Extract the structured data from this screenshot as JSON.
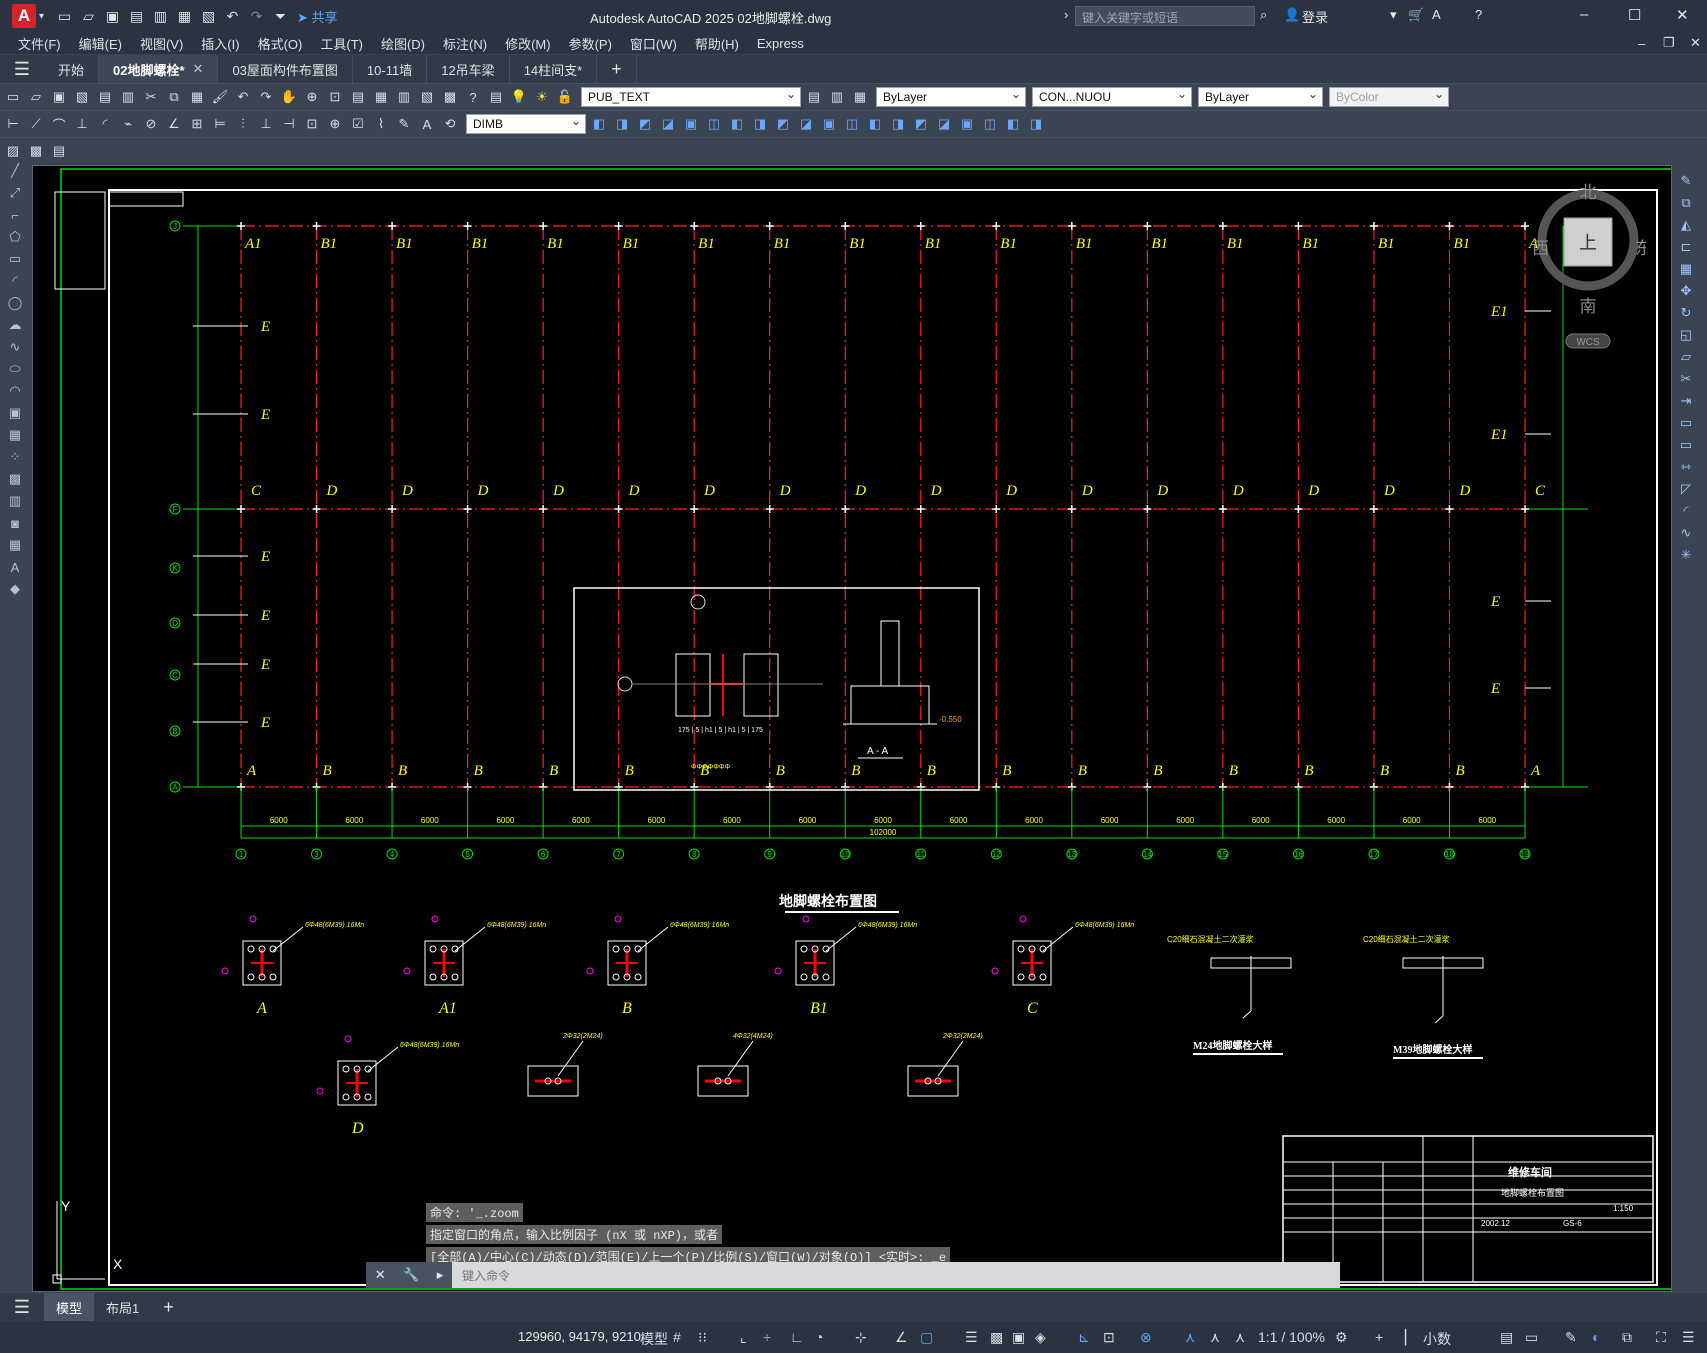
{
  "titlebar": {
    "app_logo": "A",
    "share_label": "共享",
    "app_title": "Autodesk AutoCAD 2025    02地脚螺栓.dwg",
    "search_placeholder": "键入关键字或短语",
    "signin_label": "登录"
  },
  "menu": [
    "文件(F)",
    "编辑(E)",
    "视图(V)",
    "插入(I)",
    "格式(O)",
    "工具(T)",
    "绘图(D)",
    "标注(N)",
    "修改(M)",
    "参数(P)",
    "窗口(W)",
    "帮助(H)",
    "Express"
  ],
  "tabs": [
    {
      "label": "开始"
    },
    {
      "label": "02地脚螺栓*",
      "close": "✕"
    },
    {
      "label": "03屋面构件布置图"
    },
    {
      "label": "10-11墙"
    },
    {
      "label": "12吊车梁"
    },
    {
      "label": "14柱间支*"
    }
  ],
  "properties": {
    "layer": "PUB_TEXT",
    "color": "ByLayer",
    "linetype": "CON...NUOU",
    "lineweight": "ByLayer",
    "plotstyle": "ByColor",
    "dimstyle": "DIMB"
  },
  "drawing": {
    "main_title": "地脚螺栓布置图",
    "grid_numbers": [
      "1",
      "3",
      "4",
      "5",
      "6",
      "7",
      "8",
      "9",
      "10",
      "11",
      "12",
      "13",
      "14",
      "15",
      "16",
      "17",
      "18",
      "19"
    ],
    "grid_letters": [
      "J",
      "F",
      "K",
      "D",
      "C",
      "B",
      "A"
    ],
    "total_dim": "102000",
    "bay_dim": "6000",
    "top_labels": [
      "A1",
      "B1",
      "B1",
      "B1",
      "B1",
      "B1",
      "B1",
      "B1",
      "B1",
      "B1",
      "B1",
      "B1",
      "B1",
      "B1",
      "B1",
      "B1",
      "B1",
      "A1"
    ],
    "mid_labels": [
      "C",
      "D",
      "D",
      "D",
      "D",
      "D",
      "D",
      "D",
      "D",
      "D",
      "D",
      "D",
      "D",
      "D",
      "D",
      "D",
      "D",
      "C"
    ],
    "bottom_labels": [
      "A",
      "B",
      "B",
      "B",
      "B",
      "B",
      "B",
      "B",
      "B",
      "B",
      "B",
      "B",
      "B",
      "B",
      "B",
      "B",
      "B",
      "A"
    ],
    "detail_labels": [
      "A",
      "A1",
      "B",
      "B1",
      "C",
      "D",
      "E",
      "E1",
      "E"
    ],
    "anchor_note": "6Φ48(6M39) 16Mn",
    "anchor_note2": "2Φ32(2M24)",
    "anchor_note3": "4Φ32(4M24)",
    "m24_title": "M24地脚螺栓大样",
    "m39_title": "M39地脚螺栓大样",
    "c20_note": "C20细石混凝土二次灌浆",
    "section_label": "A - A",
    "elev_note": "-0.550",
    "titleblock": {
      "project": "维修车间",
      "drawing_name": "地脚螺栓布置图",
      "date": "2002.12",
      "sheet_no": "GS-6",
      "scale": "1:150"
    }
  },
  "viewcube": {
    "north": "北",
    "south": "南",
    "east": "东",
    "west": "西",
    "top": "上",
    "wcs": "WCS"
  },
  "ucs": {
    "x": "X",
    "y": "Y"
  },
  "command_history": [
    "命令: '_.zoom",
    "指定窗口的角点，输入比例因子 (nX 或 nXP)，或者",
    "[全部(A)/中心(C)/动态(D)/范围(E)/上一个(P)/比例(S)/窗口(W)/对象(O)] <实时>: _e"
  ],
  "command_placeholder": "键入命令",
  "layout_tabs": [
    "模型",
    "布局1"
  ],
  "status": {
    "coords": "129960, 94179, 9210",
    "model": "模型",
    "scale": "1:1 / 100%",
    "units": "小数"
  }
}
